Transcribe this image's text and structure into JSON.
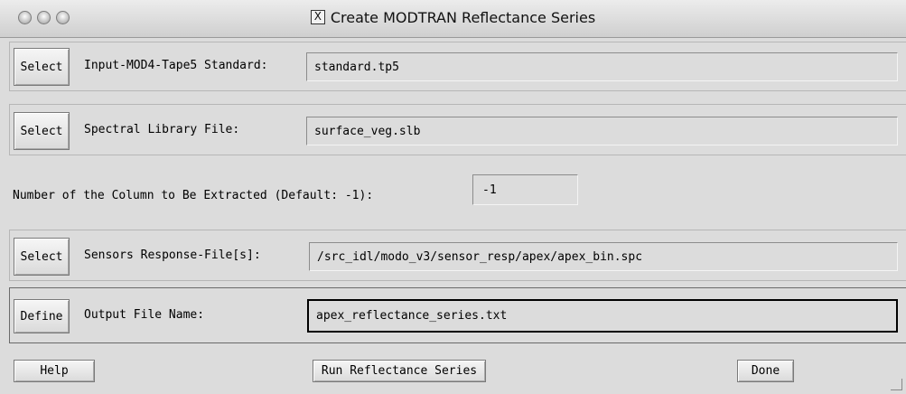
{
  "window": {
    "title": "Create MODTRAN Reflectance Series",
    "close_glyph": "X"
  },
  "rows": [
    {
      "button": "Select",
      "label": "Input-MOD4-Tape5 Standard:",
      "value": "standard.tp5"
    },
    {
      "button": "Select",
      "label": "Spectral Library File:",
      "value": "surface_veg.slb"
    },
    {
      "label": "Number of the Column to Be Extracted (Default: -1):",
      "value": "-1"
    },
    {
      "button": "Select",
      "label": "Sensors Response-File[s]:",
      "value": "/src_idl/modo_v3/sensor_resp/apex/apex_bin.spc"
    },
    {
      "button": "Define",
      "label": "Output File Name:",
      "value": "apex_reflectance_series.txt"
    }
  ],
  "footer": {
    "help": "Help",
    "run": "Run Reflectance Series",
    "done": "Done"
  }
}
